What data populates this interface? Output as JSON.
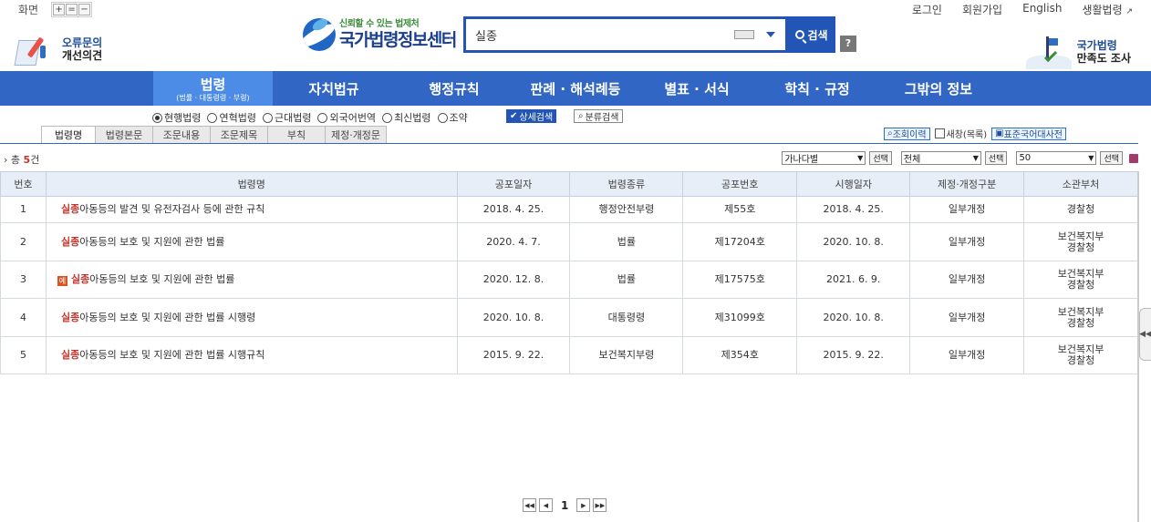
{
  "top": {
    "screen_label": "화면",
    "zoom_in": "+",
    "zoom_reset": "=",
    "zoom_out": "−",
    "links": [
      "로그인",
      "회원가입",
      "English",
      "생활법령"
    ]
  },
  "header": {
    "error_report": [
      "오류문의",
      "개선의견"
    ],
    "logo_slogan": "신뢰할 수 있는 법제처",
    "logo_name": "국가법령정보센터",
    "search_value": "실종",
    "search_button": "검색",
    "help": "?",
    "survey": [
      "국가법령",
      "만족도 조사"
    ]
  },
  "nav": {
    "items": [
      {
        "label": "법령",
        "sub": "(법률 · 대통령령 · 부령)"
      },
      {
        "label": "자치법규"
      },
      {
        "label": "행정규칙"
      },
      {
        "label": "판례 · 해석례등"
      },
      {
        "label": "별표 · 서식"
      },
      {
        "label": "학칙 · 규정"
      },
      {
        "label": "그밖의 정보"
      }
    ]
  },
  "law_types": [
    "현행법령",
    "연혁법령",
    "근대법령",
    "외국어번역",
    "최신법령",
    "조약"
  ],
  "detail_search": "상세검색",
  "category_search": "분류검색",
  "tabs": [
    "법령명",
    "법령본문",
    "조문내용",
    "조문제목",
    "부칙",
    "제정·개정문"
  ],
  "tools": {
    "history": "조회이력",
    "new_window": "새창(목록)",
    "dictionary": "표준국어대사전"
  },
  "results": {
    "count_prefix": "총",
    "count": "5",
    "count_suffix": "건",
    "sort_select": "가나다별",
    "filter_select": "전체",
    "per_page_select": "50",
    "select_button": "선택",
    "columns": [
      "번호",
      "법령명",
      "공포일자",
      "법령종류",
      "공포번호",
      "시행일자",
      "제정·개정구분",
      "소관부처"
    ],
    "rows": [
      {
        "num": "1",
        "badge": "",
        "keyword": "실종",
        "name": "아동등의 발견 및 유전자검사 등에 관한 규칙",
        "date": "2018. 4. 25.",
        "kind": "행정안전부령",
        "no": "제55호",
        "eff": "2018. 4. 25.",
        "rev": "일부개정",
        "dept": [
          "경찰청"
        ]
      },
      {
        "num": "2",
        "badge": "",
        "keyword": "실종",
        "name": "아동등의 보호 및 지원에 관한 법률",
        "date": "2020. 4. 7.",
        "kind": "법률",
        "no": "제17204호",
        "eff": "2020. 10. 8.",
        "rev": "일부개정",
        "dept": [
          "보건복지부",
          "경찰청"
        ]
      },
      {
        "num": "3",
        "badge": "예",
        "keyword": "실종",
        "name": "아동등의 보호 및 지원에 관한 법률",
        "date": "2020. 12. 8.",
        "kind": "법률",
        "no": "제17575호",
        "eff": "2021. 6. 9.",
        "rev": "일부개정",
        "dept": [
          "보건복지부",
          "경찰청"
        ]
      },
      {
        "num": "4",
        "badge": "",
        "keyword": "실종",
        "name": "아동등의 보호 및 지원에 관한 법률 시행령",
        "date": "2020. 10. 8.",
        "kind": "대통령령",
        "no": "제31099호",
        "eff": "2020. 10. 8.",
        "rev": "일부개정",
        "dept": [
          "보건복지부",
          "경찰청"
        ]
      },
      {
        "num": "5",
        "badge": "",
        "keyword": "실종",
        "name": "아동등의 보호 및 지원에 관한 법률 시행규칙",
        "date": "2015. 9. 22.",
        "kind": "보건복지부령",
        "no": "제354호",
        "eff": "2015. 9. 22.",
        "rev": "일부개정",
        "dept": [
          "보건복지부",
          "경찰청"
        ]
      }
    ]
  },
  "pagination": {
    "current": "1"
  },
  "colors": {
    "nav": "#3266c4",
    "nav_active": "#4d8ce6",
    "highlight": "#c4342b",
    "header_bg": "#e8eef7"
  }
}
